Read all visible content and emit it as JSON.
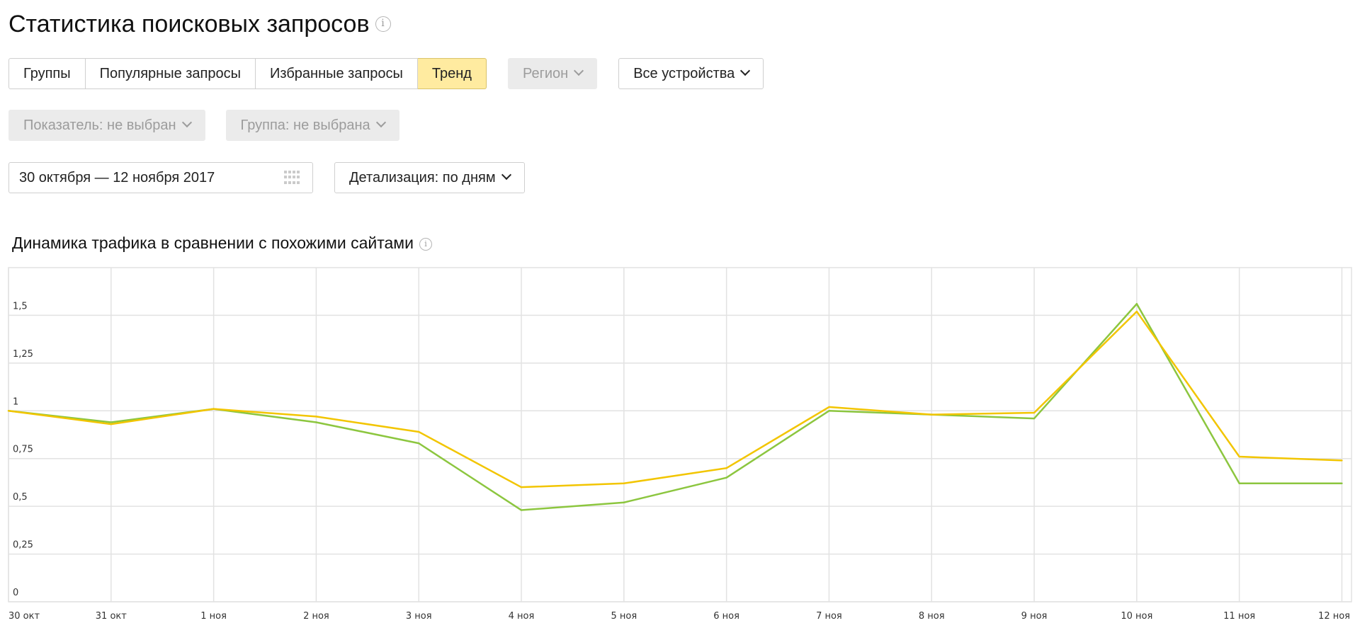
{
  "header": {
    "title": "Статистика поисковых запросов"
  },
  "tabs": [
    {
      "label": "Группы",
      "active": false
    },
    {
      "label": "Популярные запросы",
      "active": false
    },
    {
      "label": "Избранные запросы",
      "active": false
    },
    {
      "label": "Тренд",
      "active": true
    }
  ],
  "filters": {
    "region": "Регион",
    "devices": "Все устройства",
    "metric": "Показатель: не выбран",
    "group": "Группа: не выбрана",
    "date_range": "30 октября — 12 ноября 2017",
    "detail": "Детализация: по дням"
  },
  "colors": {
    "active_tab": "#ffeba0",
    "series_green": "#8cc63f",
    "series_yellow": "#f2c500"
  },
  "chart_data": {
    "type": "line",
    "title": "Динамика трафика в сравнении с похожими сайтами",
    "categories": [
      "30 окт",
      "31 окт",
      "1 ноя",
      "2 ноя",
      "3 ноя",
      "4 ноя",
      "5 ноя",
      "6 ноя",
      "7 ноя",
      "8 ноя",
      "9 ноя",
      "10 ноя",
      "11 ноя",
      "12 ноя"
    ],
    "y_ticks": [
      "0",
      "0,25",
      "0,5",
      "0,75",
      "1",
      "1,25",
      "1,5"
    ],
    "ylim": [
      0,
      1.75
    ],
    "grid": true,
    "series": [
      {
        "color": "#8cc63f",
        "values": [
          1.0,
          0.94,
          1.01,
          0.94,
          0.83,
          0.48,
          0.52,
          0.65,
          1.0,
          0.98,
          0.96,
          1.56,
          0.62,
          0.62
        ]
      },
      {
        "color": "#f2c500",
        "values": [
          1.0,
          0.93,
          1.01,
          0.97,
          0.89,
          0.6,
          0.62,
          0.7,
          1.02,
          0.98,
          0.99,
          1.52,
          0.76,
          0.74
        ]
      }
    ]
  }
}
